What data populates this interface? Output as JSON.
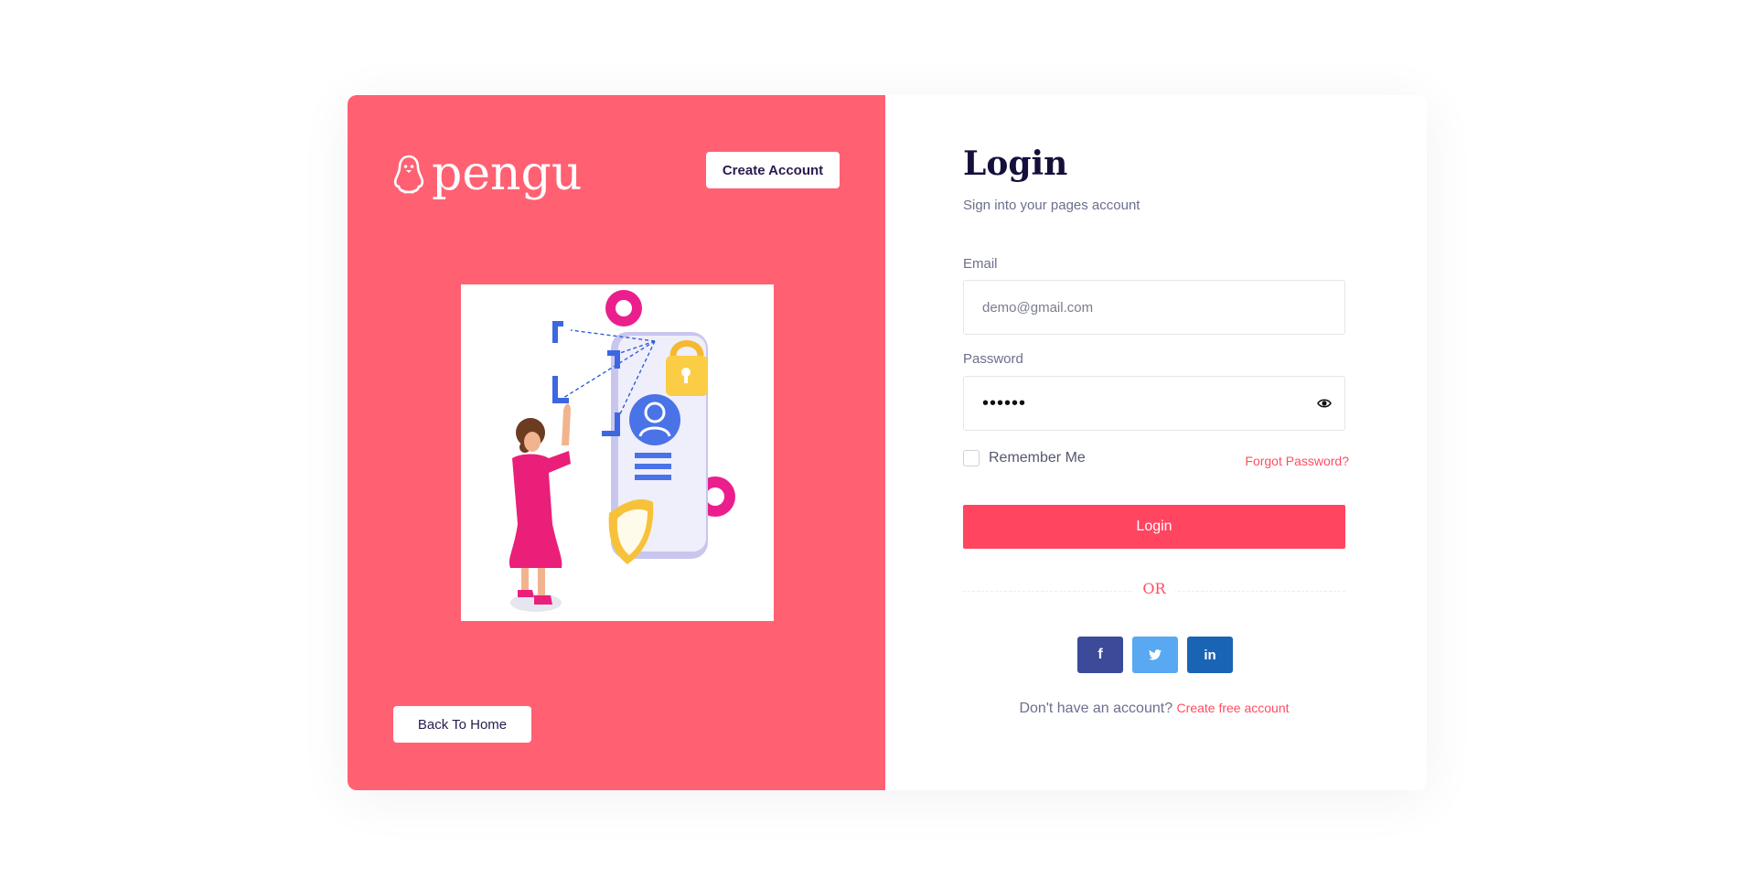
{
  "brand": {
    "name": "pengu",
    "icon": "penguin-icon"
  },
  "left_panel": {
    "create_account_label": "Create Account",
    "back_home_label": "Back To Home",
    "background_color": "#ff6172"
  },
  "login": {
    "title": "Login",
    "subtitle": "Sign into your pages account",
    "email_label": "Email",
    "email_placeholder": "demo@gmail.com",
    "password_label": "Password",
    "password_value": "••••••",
    "remember_label": "Remember Me",
    "remember_checked": false,
    "forgot_label": "Forgot Password?",
    "submit_label": "Login",
    "or_label": "OR",
    "social": [
      {
        "name": "facebook",
        "icon": "facebook-icon",
        "glyph": "f",
        "color": "#3b4a99"
      },
      {
        "name": "twitter",
        "icon": "twitter-icon",
        "color": "#58a8f2"
      },
      {
        "name": "linkedin",
        "icon": "linkedin-icon",
        "glyph": "in",
        "color": "#1a64b5"
      }
    ],
    "signup_prompt": "Don't have an account?",
    "signup_link": "Create free account",
    "accent_color": "#ff4560"
  }
}
